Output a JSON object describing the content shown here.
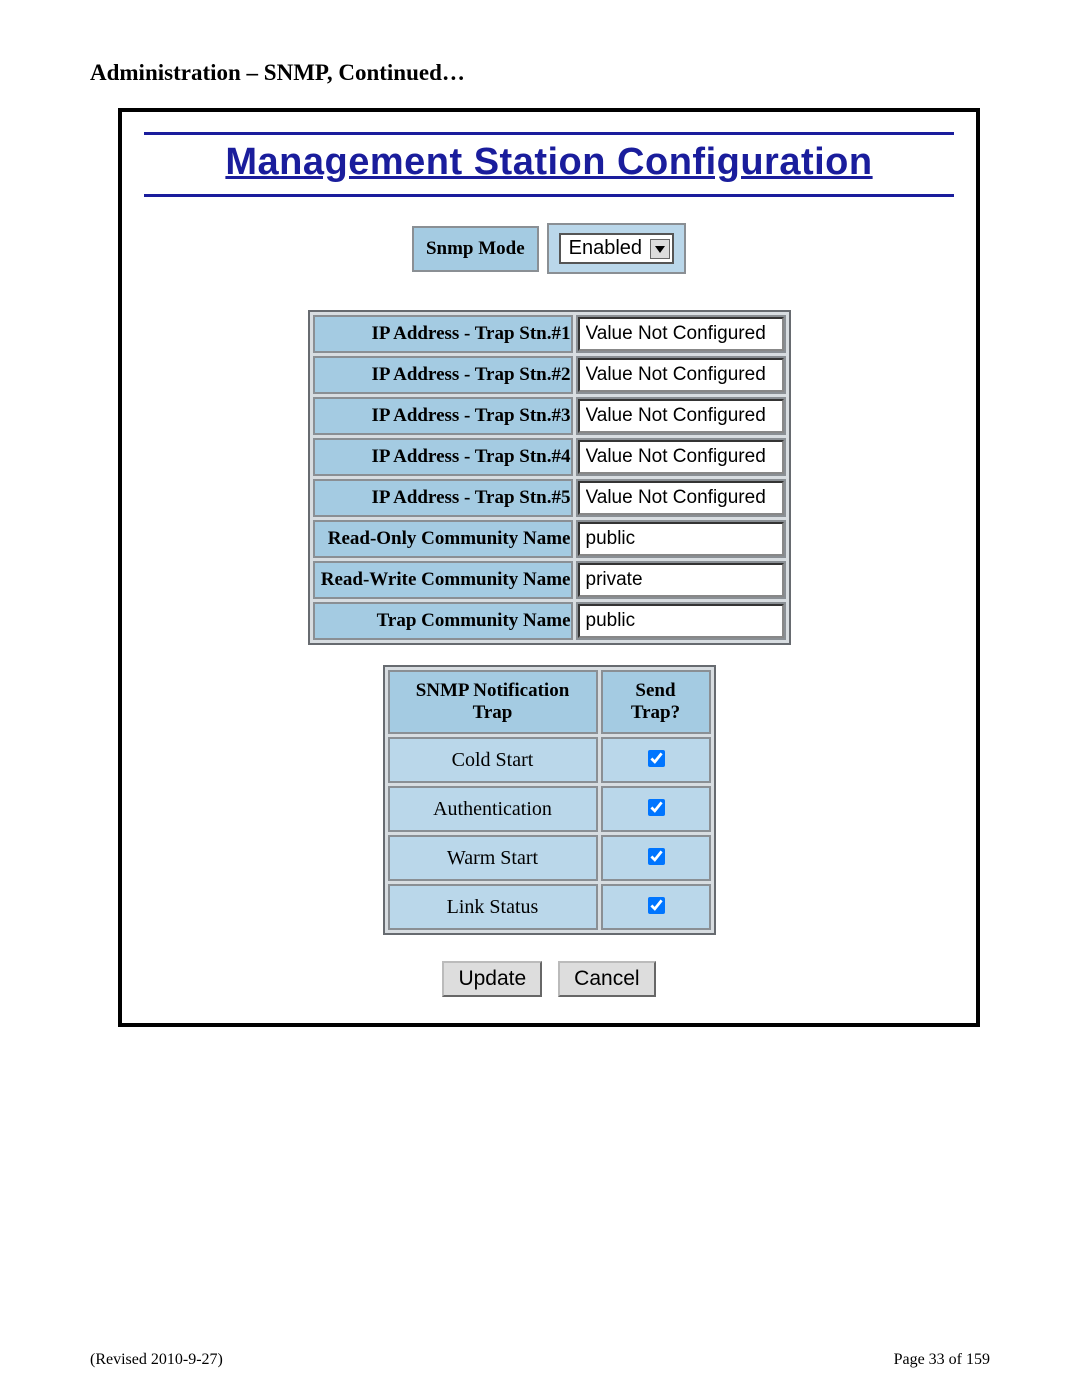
{
  "page": {
    "section_heading": "Administration – SNMP, Continued…",
    "revised": "(Revised 2010-9-27)",
    "page_number": "Page 33 of 159"
  },
  "panel": {
    "title": "Management Station Configuration",
    "mode_label": "Snmp Mode",
    "mode_value": "Enabled"
  },
  "config_rows": [
    {
      "label": "IP Address - Trap Stn.#1",
      "value": "Value Not Configured"
    },
    {
      "label": "IP Address - Trap Stn.#2",
      "value": "Value Not Configured"
    },
    {
      "label": "IP Address - Trap Stn.#3",
      "value": "Value Not Configured"
    },
    {
      "label": "IP Address - Trap Stn.#4",
      "value": "Value Not Configured"
    },
    {
      "label": "IP Address - Trap Stn.#5",
      "value": "Value Not Configured"
    },
    {
      "label": "Read-Only Community Name",
      "value": "public"
    },
    {
      "label": "Read-Write Community Name",
      "value": "private"
    },
    {
      "label": "Trap Community Name",
      "value": "public"
    }
  ],
  "trap_table": {
    "headers": [
      "SNMP Notification Trap",
      "Send Trap?"
    ],
    "rows": [
      {
        "name": "Cold Start",
        "checked": true
      },
      {
        "name": "Authentication",
        "checked": true
      },
      {
        "name": "Warm Start",
        "checked": true
      },
      {
        "name": "Link Status",
        "checked": true
      }
    ]
  },
  "buttons": {
    "update": "Update",
    "cancel": "Cancel"
  }
}
